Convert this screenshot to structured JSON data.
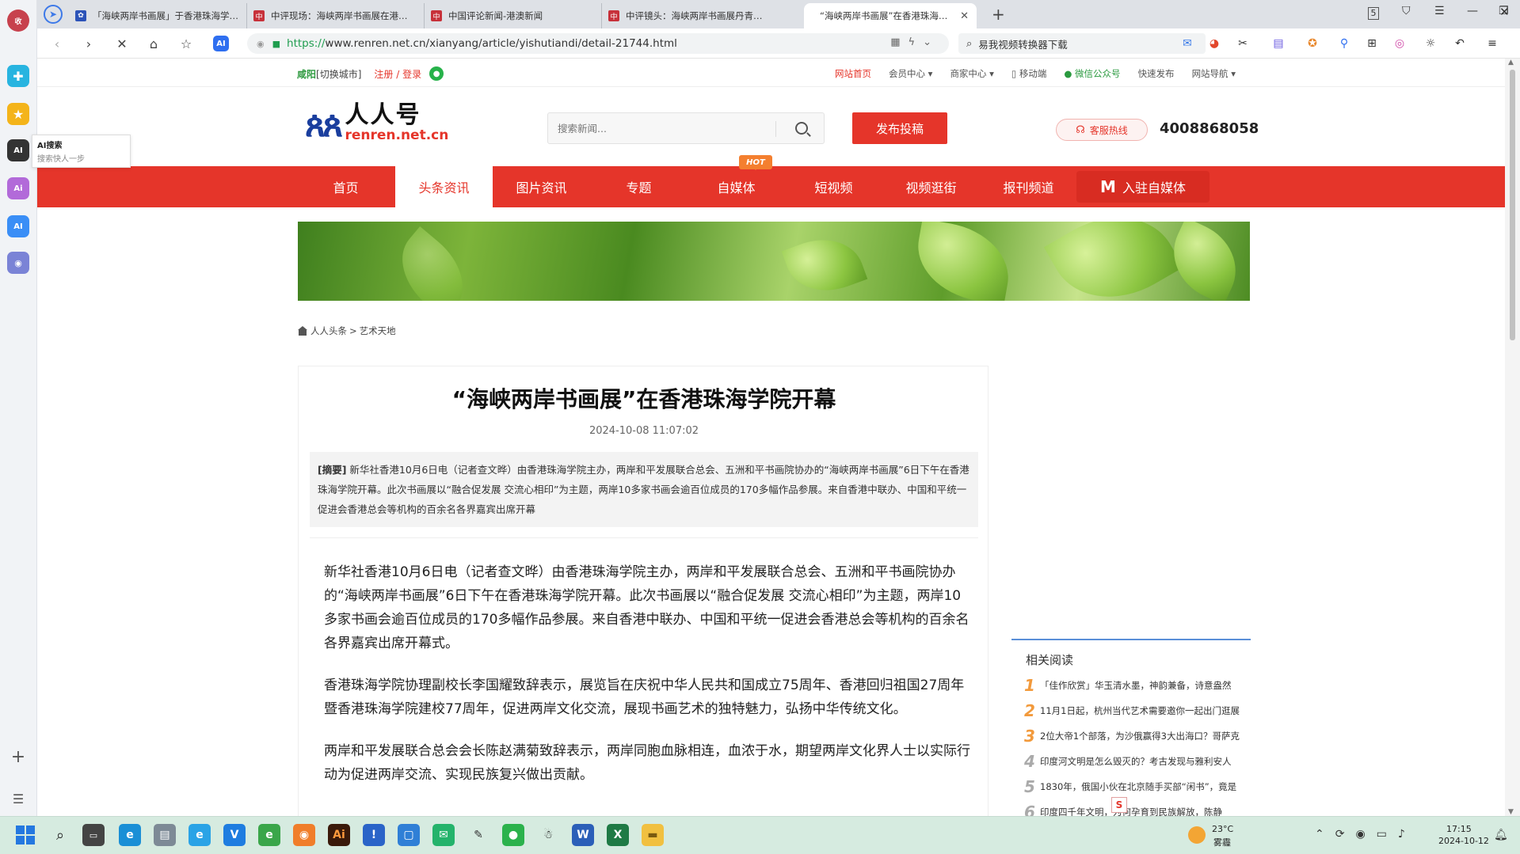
{
  "browser": {
    "tabs": [
      {
        "label": "「海峡两岸书画展」于香港珠海学院开幕",
        "favicon": "paw"
      },
      {
        "label": "中评现场：海峡两岸书画展在港开幕",
        "favicon": "cr"
      },
      {
        "label": "中国评论新闻-港澳新闻",
        "favicon": "cr"
      },
      {
        "label": "中评镜头：海峡两岸书画展丹青传情",
        "favicon": "cr"
      },
      {
        "label": "“海峡两岸书画展”在香港珠海学院开幕",
        "favicon": "cr",
        "active": true
      }
    ],
    "address": {
      "protocol": "https://",
      "rest": "www.renren.net.cn/xianyang/article/yishutiandi/detail-21744.html"
    },
    "search_box": "易我视频转换器下载",
    "ai_tooltip": {
      "title": "AI搜索",
      "subtitle": "搜索快人一步"
    },
    "ai_button": "AI"
  },
  "site": {
    "util_bar": {
      "city": "咸阳",
      "switch_city": "[切换城市]",
      "register_login": "注册 / 登录",
      "links": [
        {
          "label": "网站首页",
          "style": "home"
        },
        {
          "label": "会员中心 ▾"
        },
        {
          "label": "商家中心 ▾"
        },
        {
          "label": "▯ 移动端"
        },
        {
          "label": "● 微信公众号",
          "style": "wx"
        },
        {
          "label": "快速发布"
        },
        {
          "label": "网站导航 ▾"
        }
      ]
    },
    "logo": {
      "cn": "人人号",
      "en": "renren.net.cn"
    },
    "search_placeholder": "搜索新闻...",
    "publish_button": "发布投稿",
    "hotline_label": "客服热线",
    "hotline_number": "4008868058",
    "nav": [
      {
        "label": "首页"
      },
      {
        "label": "头条资讯",
        "active": true
      },
      {
        "label": "图片资讯"
      },
      {
        "label": "专题"
      },
      {
        "label": "自媒体",
        "badge": "HOT"
      },
      {
        "label": "短视频"
      },
      {
        "label": "视频逛街"
      },
      {
        "label": "报刊频道"
      }
    ],
    "nav_join": "入驻自媒体",
    "breadcrumb": {
      "home": "人人头条",
      "separator": ">",
      "current": "艺术天地"
    }
  },
  "article": {
    "title": "“海峡两岸书画展”在香港珠海学院开幕",
    "date": "2024-10-08 11:07:02",
    "summary_tag": "[摘要]",
    "summary": "新华社香港10月6日电（记者查文晔）由香港珠海学院主办，两岸和平发展联合总会、五洲和平书画院协办的“海峡两岸书画展”6日下午在香港珠海学院开幕。此次书画展以“融合促发展 交流心相印”为主题，两岸10多家书画会逾百位成员的170多幅作品参展。来自香港中联办、中国和平统一促进会香港总会等机构的百余名各界嘉宾出席开幕",
    "paragraphs": [
      "新华社香港10月6日电（记者查文晔）由香港珠海学院主办，两岸和平发展联合总会、五洲和平书画院协办的“海峡两岸书画展”6日下午在香港珠海学院开幕。此次书画展以“融合促发展 交流心相印”为主题，两岸10多家书画会逾百位成员的170多幅作品参展。来自香港中联办、中国和平统一促进会香港总会等机构的百余名各界嘉宾出席开幕式。",
      "香港珠海学院协理副校长李国耀致辞表示，展览旨在庆祝中华人民共和国成立75周年、香港回归祖国27周年暨香港珠海学院建校77周年，促进两岸文化交流，展现书画艺术的独特魅力，弘扬中华传统文化。",
      "两岸和平发展联合总会会长陈赵满菊致辞表示，两岸同胞血脉相连，血浓于水，期望两岸文化界人士以实际行动为促进两岸交流、实现民族复兴做出贡献。"
    ]
  },
  "related": {
    "title": "相关阅读",
    "items": [
      {
        "num": "1",
        "text": "「佳作欣赏」华玉清水墨，神韵兼备，诗意盎然"
      },
      {
        "num": "2",
        "text": "11月1日起，杭州当代艺术需要邀你一起出门逛展"
      },
      {
        "num": "3",
        "text": "2位大帝1个部落，为沙俄赢得3大出海口？哥萨克"
      },
      {
        "num": "4",
        "text": "印度河文明是怎么毁灭的？考古发现与雅利安人"
      },
      {
        "num": "5",
        "text": "1830年，俄国小伙在北京随手买部“闲书”，竟是"
      },
      {
        "num": "6",
        "text": "印度四千年文明，为何孕育到民族解放，陈静"
      }
    ],
    "float_badge": "S"
  },
  "taskbar": {
    "weather_temp": "23°C",
    "weather_desc": "雾霾",
    "time": "17:15",
    "date": "2024-10-12"
  },
  "colors": {
    "brand_red": "#e5352a",
    "nav_red": "#e5352a",
    "link_green": "#1f9d4f"
  }
}
